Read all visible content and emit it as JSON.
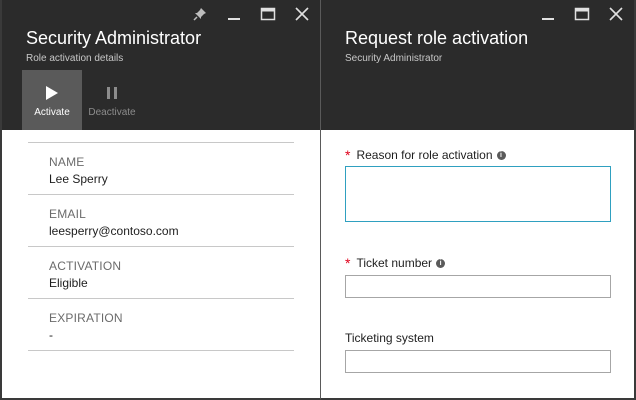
{
  "left_blade": {
    "title": "Security Administrator",
    "subtitle": "Role activation details",
    "toolbar": {
      "activate_label": "Activate",
      "deactivate_label": "Deactivate"
    },
    "details": [
      {
        "label": "NAME",
        "value": "Lee Sperry"
      },
      {
        "label": "EMAIL",
        "value": "leesperry@contoso.com"
      },
      {
        "label": "ACTIVATION",
        "value": "Eligible"
      },
      {
        "label": "EXPIRATION",
        "value": "-"
      }
    ]
  },
  "right_blade": {
    "title": "Request role activation",
    "subtitle": "Security Administrator",
    "form": {
      "reason_label": "Reason for role activation",
      "reason_value": "",
      "ticket_number_label": "Ticket number",
      "ticket_number_value": "",
      "ticketing_system_label": "Ticketing system",
      "ticketing_system_value": "",
      "required_marker": "*",
      "info_glyph": "i"
    }
  },
  "icons": [
    "pin-icon",
    "minimize-icon",
    "maximize-icon",
    "close-icon",
    "play-icon",
    "pause-icon",
    "info-icon"
  ],
  "colors": {
    "header_bg": "#2b2b2b",
    "active_tool_bg": "#5a5a5a",
    "required_asterisk": "#e0001b",
    "focused_input_border": "#2fa0c0"
  }
}
